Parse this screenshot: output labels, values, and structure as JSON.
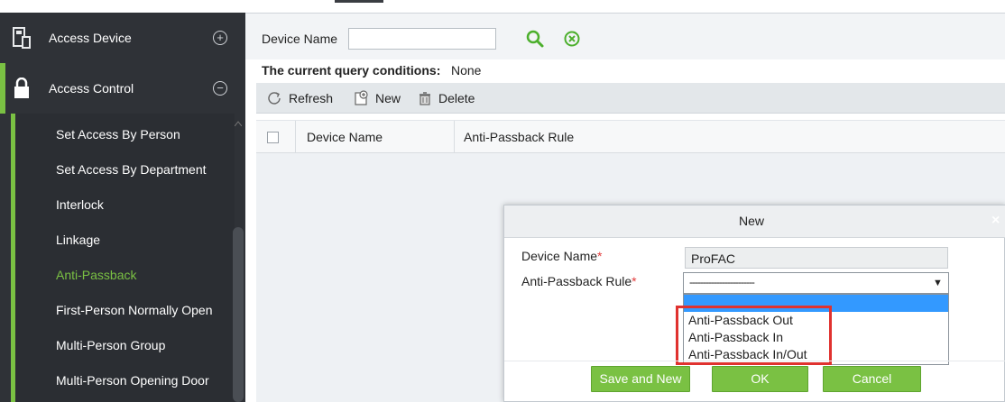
{
  "sidebar": {
    "menus": [
      {
        "label": "Access Device",
        "toggle": "+"
      },
      {
        "label": "Access Control",
        "toggle": "−"
      }
    ],
    "items": [
      {
        "label": "Set Access By Person"
      },
      {
        "label": "Set Access By Department"
      },
      {
        "label": "Interlock"
      },
      {
        "label": "Linkage"
      },
      {
        "label": "Anti-Passback",
        "active": true
      },
      {
        "label": "First-Person Normally Open"
      },
      {
        "label": "Multi-Person Group"
      },
      {
        "label": "Multi-Person Opening Door"
      }
    ],
    "active_color": "#7ac143"
  },
  "search": {
    "device_name_label": "Device Name",
    "device_name_value": ""
  },
  "query": {
    "label": "The current query conditions:",
    "value": "None"
  },
  "toolbar": {
    "refresh": "Refresh",
    "new": "New",
    "delete": "Delete"
  },
  "table": {
    "columns": [
      "Device Name",
      "Anti-Passback Rule"
    ]
  },
  "modal": {
    "title": "New",
    "close": "×",
    "fields": {
      "device_name_label": "Device Name",
      "device_name_value": "ProFAC",
      "rule_label": "Anti-Passback Rule",
      "required_mark": "*",
      "rule_selected": "------------------------"
    },
    "rule_options": [
      "Anti-Passback Out",
      "Anti-Passback In",
      "Anti-Passback In/Out"
    ],
    "buttons": {
      "save_new": "Save and New",
      "ok": "OK",
      "cancel": "Cancel"
    }
  },
  "colors": {
    "accent": "#7ac143",
    "sidebar_bg": "#2f3237",
    "highlight": "#3399ff",
    "annotation": "#e0322f"
  }
}
